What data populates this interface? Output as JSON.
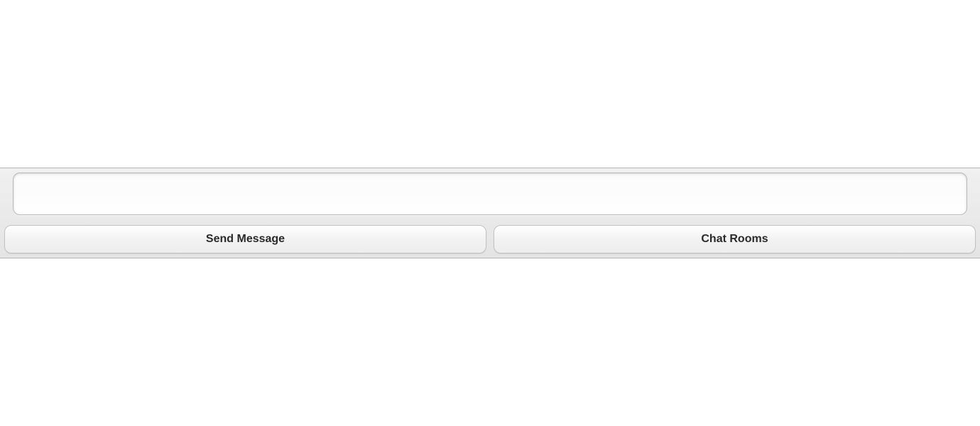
{
  "footer": {
    "message_input": {
      "value": "",
      "placeholder": ""
    },
    "buttons": {
      "send_label": "Send Message",
      "rooms_label": "Chat Rooms"
    }
  }
}
